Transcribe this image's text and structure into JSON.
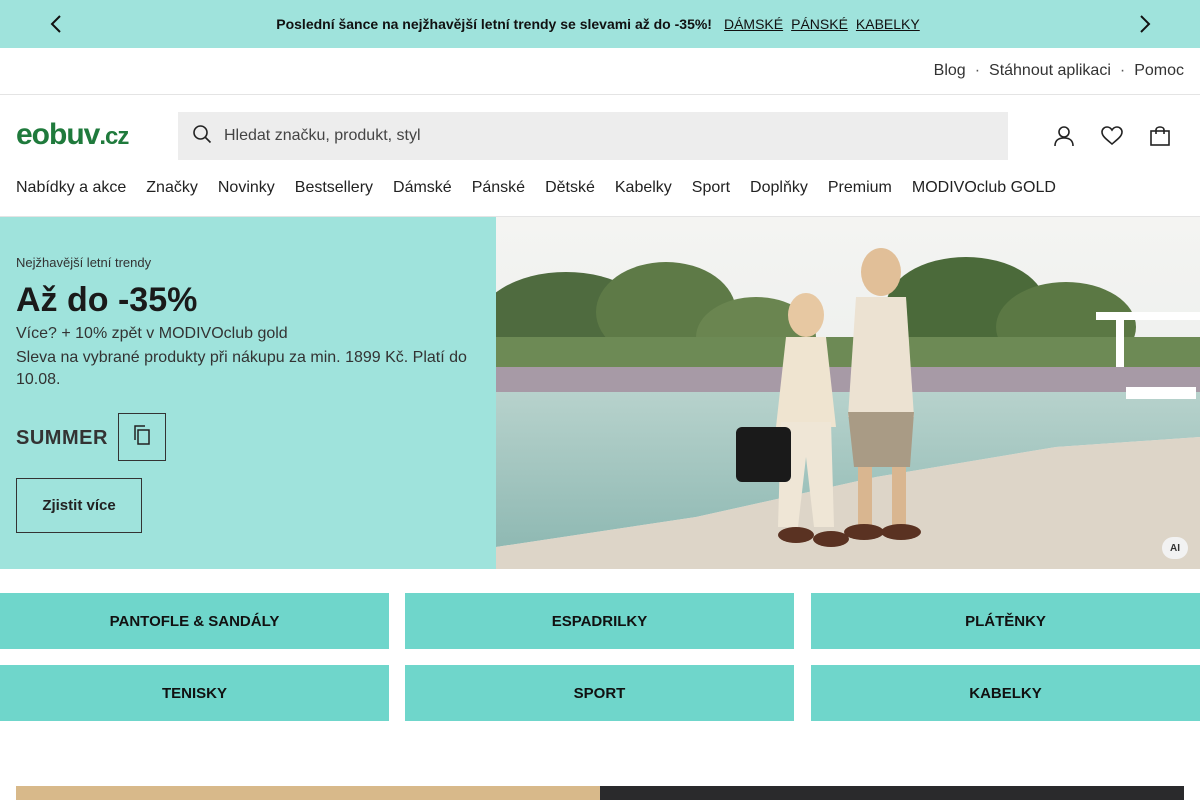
{
  "promo": {
    "message": "Poslední šance na nejžhavější letní trendy se slevami až do -35%!",
    "links": [
      "DÁMSKÉ",
      "PÁNSKÉ",
      "KABELKY"
    ]
  },
  "util_links": [
    "Blog",
    "Stáhnout aplikaci",
    "Pomoc"
  ],
  "util_separator": "·",
  "logo": {
    "main": "eobuv",
    "tld": ".cz"
  },
  "search": {
    "placeholder": "Hledat značku, produkt, styl"
  },
  "nav": [
    "Nabídky a akce",
    "Značky",
    "Novinky",
    "Bestsellery",
    "Dámské",
    "Pánské",
    "Dětské",
    "Kabelky",
    "Sport",
    "Doplňky",
    "Premium",
    "MODIVOclub GOLD"
  ],
  "hero": {
    "kicker": "Nejžhavější letní trendy",
    "headline": "Až do -35%",
    "sub1": "Více? + 10% zpět v MODIVOclub gold",
    "sub2": "Sleva na vybrané produkty při nákupu za min. 1899 Kč. Platí do 10.08.",
    "code": "SUMMER",
    "cta": "Zjistit více",
    "badge": "AI"
  },
  "categories": [
    "PANTOFLE & SANDÁLY",
    "ESPADRILKY",
    "PLÁTĚNKY",
    "TENISKY",
    "SPORT",
    "KABELKY"
  ],
  "colors": {
    "promo_bg": "#9fe3dc",
    "tile_bg": "#6fd6cb",
    "logo": "#1f7a3c"
  }
}
